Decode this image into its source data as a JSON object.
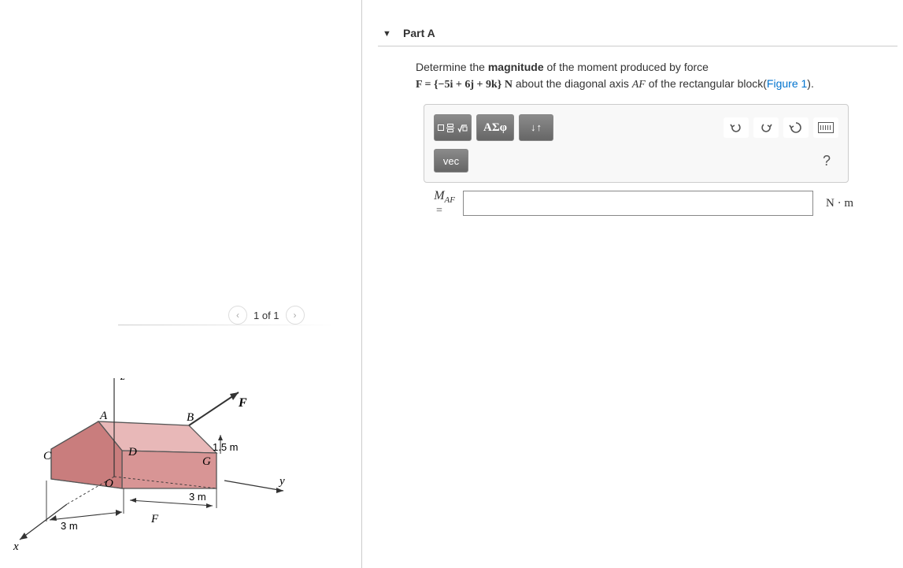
{
  "figure_nav": {
    "prev": "‹",
    "counter": "1 of 1",
    "next": "›"
  },
  "figure": {
    "axes": {
      "x": "x",
      "y": "y",
      "z": "z"
    },
    "points": {
      "A": "A",
      "B": "B",
      "C": "C",
      "D": "D",
      "F": "F",
      "G": "G",
      "O": "O"
    },
    "force_label": "F",
    "dims": {
      "h": "1.5 m",
      "d1": "3 m",
      "d2": "3 m"
    }
  },
  "part": {
    "title": "Part A",
    "prompt1": "Determine the ",
    "prompt_bold": "magnitude",
    "prompt2": " of the moment produced by force ",
    "equation": "F = {−5i + 6j + 9k} N",
    "prompt3": " about the diagonal axis ",
    "axis": "AF",
    "prompt4": " of the rectangular block(",
    "figlink": "Figure 1",
    "prompt5": ")."
  },
  "toolbar": {
    "templates": "templates",
    "special": "ΑΣφ",
    "scinot": "↓↑",
    "undo": "↶",
    "redo": "↷",
    "reset": "↻",
    "keyboard": "keyboard",
    "vec": "vec",
    "help": "?"
  },
  "answer": {
    "symbol_main": "M",
    "symbol_sub": "AF",
    "equals": "=",
    "value": "",
    "unit": "N · m"
  }
}
